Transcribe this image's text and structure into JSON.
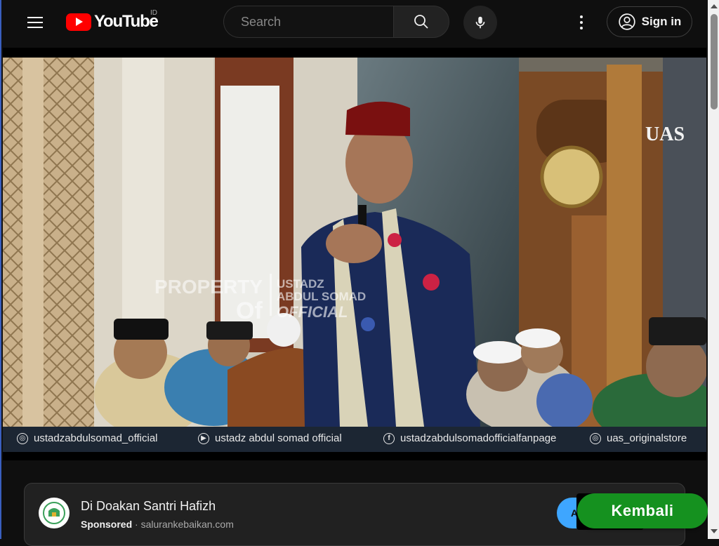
{
  "header": {
    "logo_text": "YouTube",
    "country_code": "ID",
    "search_placeholder": "Search",
    "signin_label": "Sign in"
  },
  "video": {
    "watermark_line1": "PROPERTY",
    "watermark_line2": "Of",
    "watermark_channel": [
      "USTADZ",
      "ABDUL SOMAD",
      "OFFICIAL"
    ],
    "corner_logo": "UAS",
    "socials": [
      {
        "icon": "instagram-icon",
        "label": "ustadzabdulsomad_official"
      },
      {
        "icon": "youtube-icon",
        "label": "ustadz abdul somad official"
      },
      {
        "icon": "facebook-icon",
        "label": "ustadzabdulsomadofficialfanpage"
      },
      {
        "icon": "instagram-icon",
        "label": "uas_originalstore"
      }
    ]
  },
  "ad": {
    "title": "Di Doakan Santri Hafizh",
    "sponsored": "Sponsored",
    "separator": "·",
    "domain": "salurankebaikan.com",
    "cta_partial": "A"
  },
  "overlay": {
    "back_button": "Kembali"
  },
  "colors": {
    "background": "#0f0f0f",
    "brand_red": "#ff0000",
    "kembali_green": "#15911f",
    "cta_blue": "#3ea6ff"
  }
}
